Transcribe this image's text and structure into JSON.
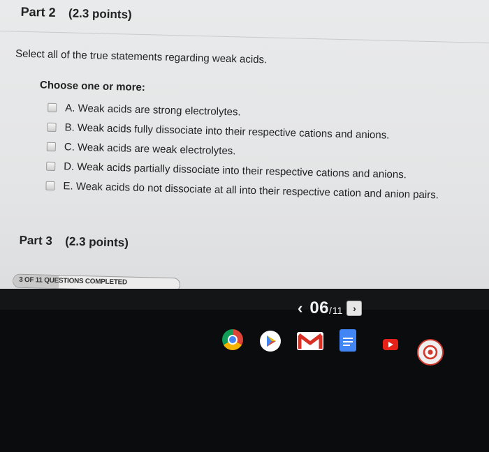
{
  "part2": {
    "number": "Part 2",
    "points": "(2.3 points)"
  },
  "question": {
    "prompt": "Select all of the true statements regarding weak acids.",
    "instruction": "Choose one or more:",
    "options": [
      {
        "text": "A. Weak acids are strong electrolytes.",
        "checked": false
      },
      {
        "text": "B. Weak acids fully dissociate into their respective cations and anions.",
        "checked": false
      },
      {
        "text": "C. Weak acids are weak electrolytes.",
        "checked": false
      },
      {
        "text": "D. Weak acids partially dissociate into their respective cations and anions.",
        "checked": false
      },
      {
        "text": "E. Weak acids do not dissociate at all into their respective cation and anion pairs.",
        "checked": false
      }
    ]
  },
  "part3": {
    "number": "Part 3",
    "points": "(2.3 points)"
  },
  "progress": {
    "label": "3 OF 11 QUESTIONS COMPLETED",
    "completed": 3,
    "total": 11
  },
  "pager": {
    "current": "06",
    "separator": "/",
    "total": "11",
    "prev_icon": "chevron-left-icon",
    "next_icon": "chevron-right-icon"
  },
  "shelf": {
    "apps": [
      {
        "name": "Chrome",
        "icon": "chrome-icon"
      },
      {
        "name": "Play Store",
        "icon": "play-store-icon"
      },
      {
        "name": "Gmail",
        "icon": "gmail-icon"
      },
      {
        "name": "Docs",
        "icon": "docs-icon"
      },
      {
        "name": "YouTube",
        "icon": "youtube-icon"
      },
      {
        "name": "Camera",
        "icon": "camera-icon"
      }
    ]
  },
  "colors": {
    "screen_bg": "#e6e7e8",
    "bezel": "#0b0c0d",
    "text": "#222222"
  }
}
